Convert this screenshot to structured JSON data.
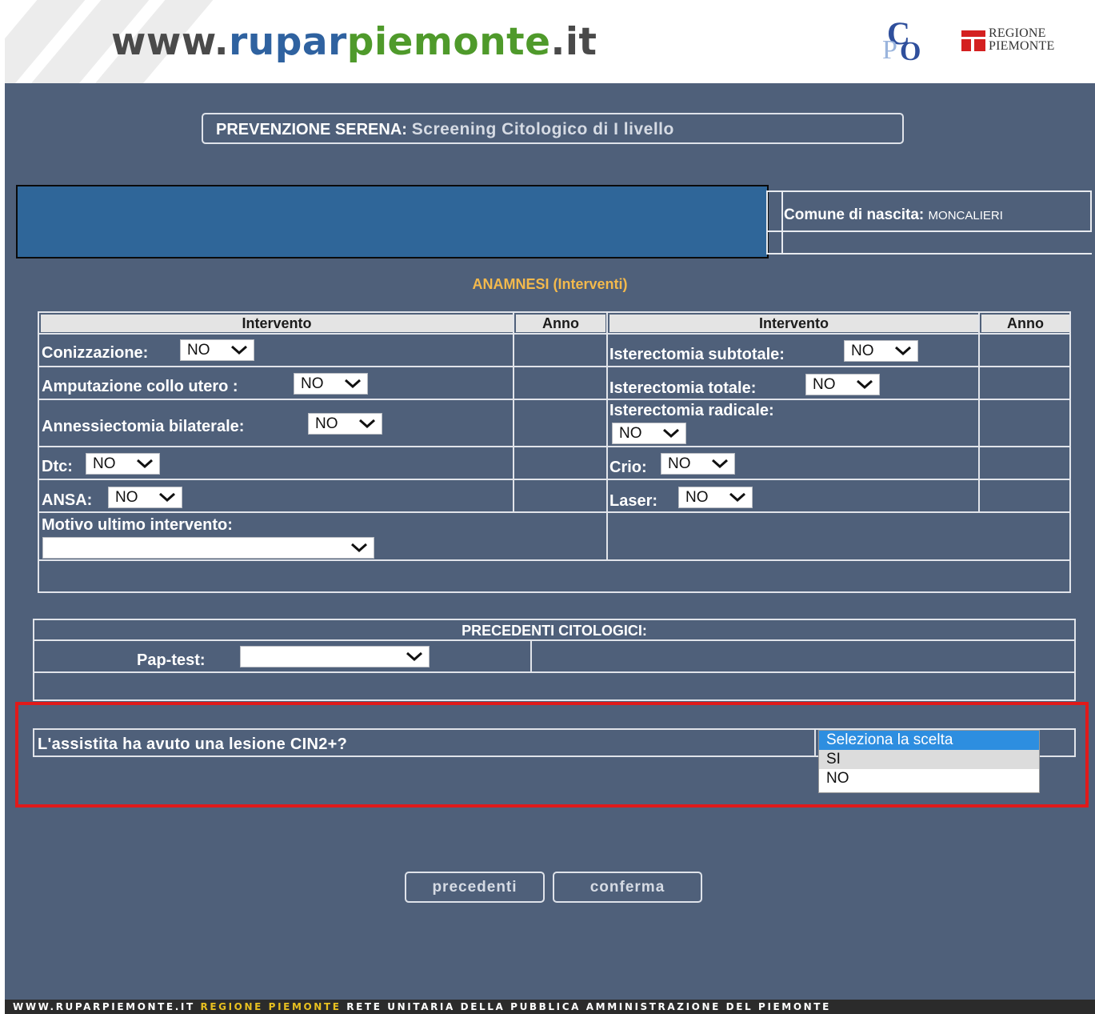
{
  "header": {
    "logo_prefix": "www.",
    "logo_rupar": "rupar",
    "logo_piemonte": "piemonte",
    "logo_suffix": ".it",
    "cpo_c": "C",
    "cpo_p": "P",
    "cpo_o": "O",
    "regione_line1": "REGIONE",
    "regione_line2": "PIEMONTE"
  },
  "title": {
    "prefix": "PREVENZIONE SERENA:",
    "subtitle": "Screening Citologico di I livello"
  },
  "patient": {
    "birth_label": "Comune di nascita:",
    "birth_value": "MONCALIERI"
  },
  "anamnesi": {
    "title": "ANAMNESI (Interventi)",
    "col_intervento": "Intervento",
    "col_anno": "Anno",
    "left_rows": [
      {
        "label": "Conizzazione:",
        "value": "NO"
      },
      {
        "label": "Amputazione collo utero :",
        "value": "NO"
      },
      {
        "label": "Annessiectomia bilaterale:",
        "value": "NO"
      },
      {
        "label": "Dtc:",
        "value": "NO"
      },
      {
        "label": "ANSA:",
        "value": "NO"
      }
    ],
    "right_rows": [
      {
        "label": "Isterectomia subtotale:",
        "value": "NO"
      },
      {
        "label": "Isterectomia totale:",
        "value": "NO"
      },
      {
        "label": "Isterectomia radicale:",
        "value": "NO"
      },
      {
        "label": "Crio:",
        "value": "NO"
      },
      {
        "label": "Laser:",
        "value": "NO"
      }
    ],
    "motivo_label": "Motivo ultimo intervento:",
    "motivo_value": ""
  },
  "precedenti": {
    "title": "PRECEDENTI CITOLOGICI:",
    "pap_label": "Pap-test:",
    "pap_value": ""
  },
  "cin": {
    "question": "L'assistita ha avuto una lesione CIN2+?",
    "options": [
      "Seleziona la scelta",
      "SI",
      "NO"
    ]
  },
  "buttons": {
    "precedenti": "precedenti",
    "conferma": "conferma"
  },
  "footer": {
    "part1": "WWW.RUPARPIEMONTE.IT",
    "part2": "REGIONE PIEMONTE",
    "part3": "RETE UNITARIA DELLA PUBBLICA AMMINISTRAZIONE DEL PIEMONTE"
  },
  "colors": {
    "background": "#4f607a",
    "accent_title": "#f3b94c",
    "highlight_border": "#e01a1a",
    "logo_blue": "#2f62a0",
    "logo_green": "#4f9a2b"
  }
}
